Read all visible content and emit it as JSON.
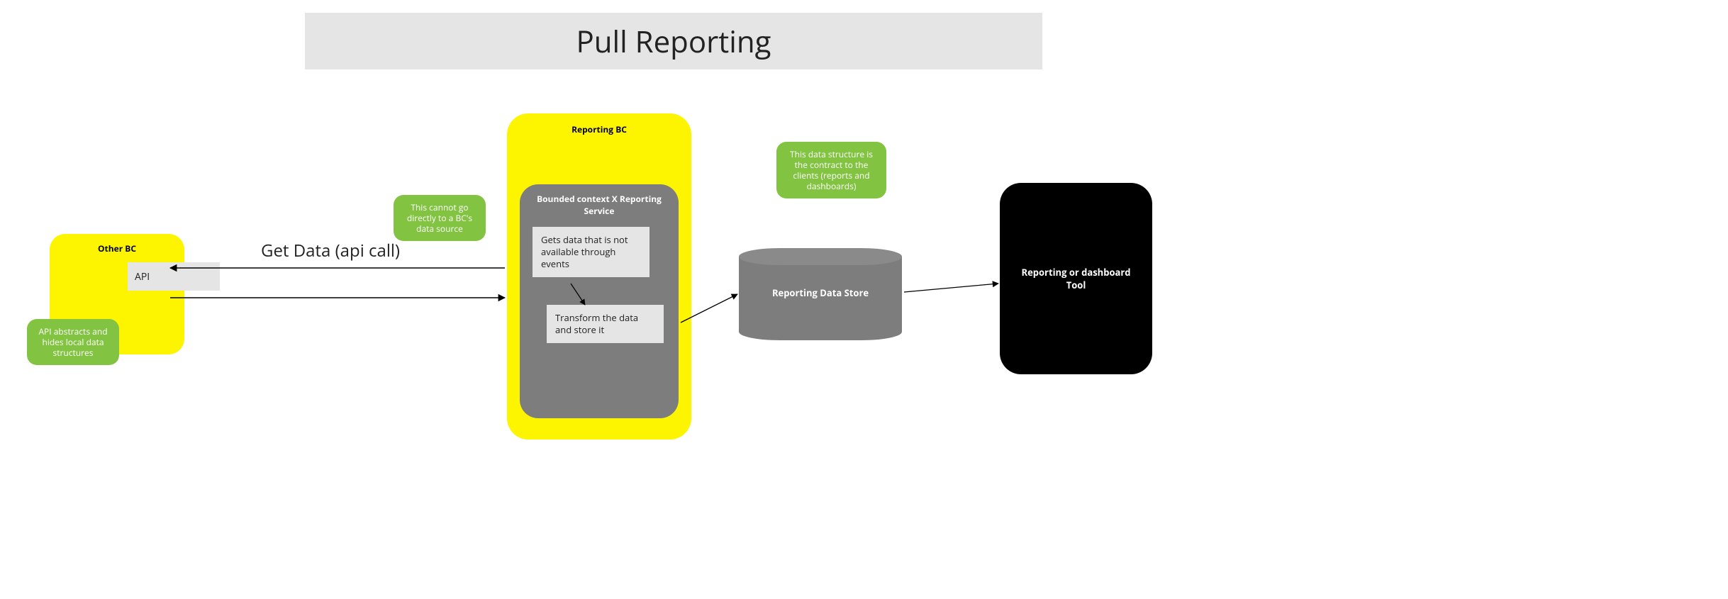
{
  "title": "Pull Reporting",
  "other_bc": {
    "label": "Other BC",
    "api_label": "API"
  },
  "notes": {
    "api_abstracts": "API abstracts and hides local data structures",
    "cannot_direct": "This cannot go directly to a BC's data source",
    "data_contract": "This data structure is the contract to the clients (reports and dashboards)"
  },
  "call_label": "Get Data (api call)",
  "reporting_bc": {
    "label": "Reporting BC",
    "service_label": "Bounded context X Reporting Service",
    "step1": "Gets data that is not available through events",
    "step2": "Transform the data and store it"
  },
  "data_store": "Reporting Data Store",
  "reporting_tool": "Reporting or dashboard Tool"
}
